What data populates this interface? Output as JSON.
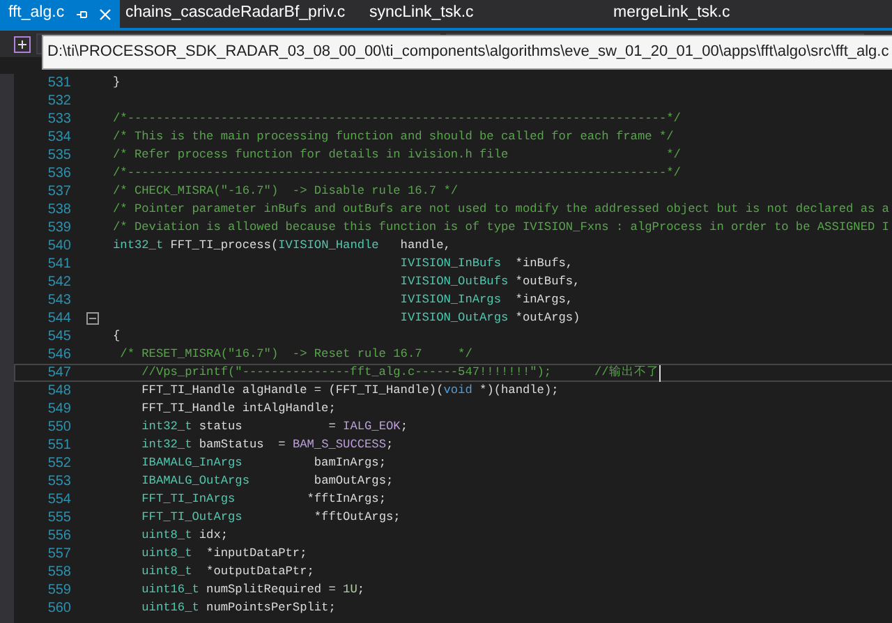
{
  "tabs": [
    {
      "label": "fft_alg.c",
      "selected": true
    },
    {
      "label": "chains_cascadeRadarBf_priv.c",
      "selected": false
    },
    {
      "label": "syncLink_tsk.c",
      "selected": false
    },
    {
      "label": "mergeLink_tsk.c",
      "selected": false
    }
  ],
  "tooltip": "D:\\ti\\PROCESSOR_SDK_RADAR_03_08_00_00\\ti_components\\algorithms\\eve_sw_01_20_01_00\\apps\\fft\\algo\\src\\fft_alg.c",
  "lines": [
    {
      "number": "531",
      "current": false,
      "tokens": [
        {
          "kind": "plain",
          "text": "}"
        }
      ]
    },
    {
      "number": "532",
      "current": false
    },
    {
      "number": "533",
      "current": false,
      "tokens": [
        {
          "kind": "comment",
          "text": "/*---------------------------------------------------------------------------*/"
        }
      ]
    },
    {
      "number": "534",
      "current": false,
      "tokens": [
        {
          "kind": "comment",
          "text": "/* This is the main processing function and should be called for each frame */"
        }
      ]
    },
    {
      "number": "535",
      "current": false,
      "tokens": [
        {
          "kind": "comment",
          "text": "/* Refer process function for details in ivision.h file                      */"
        }
      ]
    },
    {
      "number": "536",
      "current": false,
      "tokens": [
        {
          "kind": "comment",
          "text": "/*---------------------------------------------------------------------------*/"
        }
      ]
    },
    {
      "number": "537",
      "current": false,
      "tokens": [
        {
          "kind": "comment",
          "text": "/* CHECK_MISRA(\"-16.7\")  -> Disable rule 16.7 */"
        }
      ]
    },
    {
      "number": "538",
      "current": false,
      "tokens": [
        {
          "kind": "comment",
          "text": "/* Pointer parameter inBufs and outBufs are not used to modify the addressed object but is not declared as a"
        }
      ]
    },
    {
      "number": "539",
      "current": false,
      "tokens": [
        {
          "kind": "comment",
          "text": "/* Deviation is allowed because this function is of type IVISION_Fxns : algProcess in order to be ASSIGNED I"
        }
      ]
    },
    {
      "number": "540",
      "current": false,
      "tokens": [
        {
          "kind": "type",
          "text": "int32_t"
        },
        {
          "kind": "plain",
          "text": " FFT_TI_process("
        },
        {
          "kind": "type",
          "text": "IVISION_Handle"
        },
        {
          "kind": "plain",
          "text": "   handle,"
        }
      ]
    },
    {
      "number": "541",
      "current": false,
      "tokens": [
        {
          "kind": "type",
          "text": "                                        IVISION_InBufs"
        },
        {
          "kind": "plain",
          "text": "  *inBufs,"
        }
      ]
    },
    {
      "number": "542",
      "current": false,
      "tokens": [
        {
          "kind": "type",
          "text": "                                        IVISION_OutBufs"
        },
        {
          "kind": "plain",
          "text": " *outBufs,"
        }
      ]
    },
    {
      "number": "543",
      "current": false,
      "tokens": [
        {
          "kind": "type",
          "text": "                                        IVISION_InArgs"
        },
        {
          "kind": "plain",
          "text": "  *inArgs,"
        }
      ]
    },
    {
      "number": "544",
      "current": false,
      "tokens": [
        {
          "kind": "type",
          "text": "                                        IVISION_OutArgs"
        },
        {
          "kind": "plain",
          "text": " *outArgs)"
        }
      ]
    },
    {
      "number": "545",
      "current": false,
      "tokens": [
        {
          "kind": "plain",
          "text": "{"
        }
      ]
    },
    {
      "number": "546",
      "current": false,
      "tokens": [
        {
          "kind": "comment",
          "text": " /* RESET_MISRA(\"16.7\")  -> Reset rule 16.7     */"
        }
      ]
    },
    {
      "number": "547",
      "current": true,
      "tokens": [
        {
          "kind": "comment",
          "text": "    //Vps_printf(\"---------------fft_alg.c------547!!!!!!!\");      //输出不了"
        }
      ]
    },
    {
      "number": "548",
      "current": false,
      "tokens": [
        {
          "kind": "plain",
          "text": "    FFT_TI_Handle algHandle = (FFT_TI_Handle)("
        },
        {
          "kind": "keyword",
          "text": "void"
        },
        {
          "kind": "plain",
          "text": " *)(handle);"
        }
      ]
    },
    {
      "number": "549",
      "current": false,
      "tokens": [
        {
          "kind": "plain",
          "text": "    FFT_TI_Handle intAlgHandle;"
        }
      ]
    },
    {
      "number": "550",
      "current": false,
      "tokens": [
        {
          "kind": "type",
          "text": "    int32_t"
        },
        {
          "kind": "plain",
          "text": " status            = "
        },
        {
          "kind": "macro",
          "text": "IALG_EOK"
        },
        {
          "kind": "plain",
          "text": ";"
        }
      ]
    },
    {
      "number": "551",
      "current": false,
      "tokens": [
        {
          "kind": "type",
          "text": "    int32_t"
        },
        {
          "kind": "plain",
          "text": " bamStatus  = "
        },
        {
          "kind": "macro",
          "text": "BAM_S_SUCCESS"
        },
        {
          "kind": "plain",
          "text": ";"
        }
      ]
    },
    {
      "number": "552",
      "current": false,
      "tokens": [
        {
          "kind": "type",
          "text": "    IBAMALG_InArgs"
        },
        {
          "kind": "plain",
          "text": "          bamInArgs;"
        }
      ]
    },
    {
      "number": "553",
      "current": false,
      "tokens": [
        {
          "kind": "type",
          "text": "    IBAMALG_OutArgs"
        },
        {
          "kind": "plain",
          "text": "         bamOutArgs;"
        }
      ]
    },
    {
      "number": "554",
      "current": false,
      "tokens": [
        {
          "kind": "type",
          "text": "    FFT_TI_InArgs"
        },
        {
          "kind": "plain",
          "text": "          *fftInArgs;"
        }
      ]
    },
    {
      "number": "555",
      "current": false,
      "tokens": [
        {
          "kind": "type",
          "text": "    FFT_TI_OutArgs"
        },
        {
          "kind": "plain",
          "text": "          *fftOutArgs;"
        }
      ]
    },
    {
      "number": "556",
      "current": false,
      "tokens": [
        {
          "kind": "type",
          "text": "    uint8_t"
        },
        {
          "kind": "plain",
          "text": " idx;"
        }
      ]
    },
    {
      "number": "557",
      "current": false,
      "tokens": [
        {
          "kind": "type",
          "text": "    uint8_t"
        },
        {
          "kind": "plain",
          "text": "  *inputDataPtr;"
        }
      ]
    },
    {
      "number": "558",
      "current": false,
      "tokens": [
        {
          "kind": "type",
          "text": "    uint8_t"
        },
        {
          "kind": "plain",
          "text": "  *outputDataPtr;"
        }
      ]
    },
    {
      "number": "559",
      "current": false,
      "tokens": [
        {
          "kind": "type",
          "text": "    uint16_t"
        },
        {
          "kind": "plain",
          "text": " numSplitRequired = "
        },
        {
          "kind": "number",
          "text": "1U"
        },
        {
          "kind": "plain",
          "text": ";"
        }
      ]
    },
    {
      "number": "560",
      "current": false,
      "tokens": [
        {
          "kind": "type",
          "text": "    uint16_t"
        },
        {
          "kind": "plain",
          "text": " numPointsPerSplit;"
        }
      ]
    }
  ]
}
